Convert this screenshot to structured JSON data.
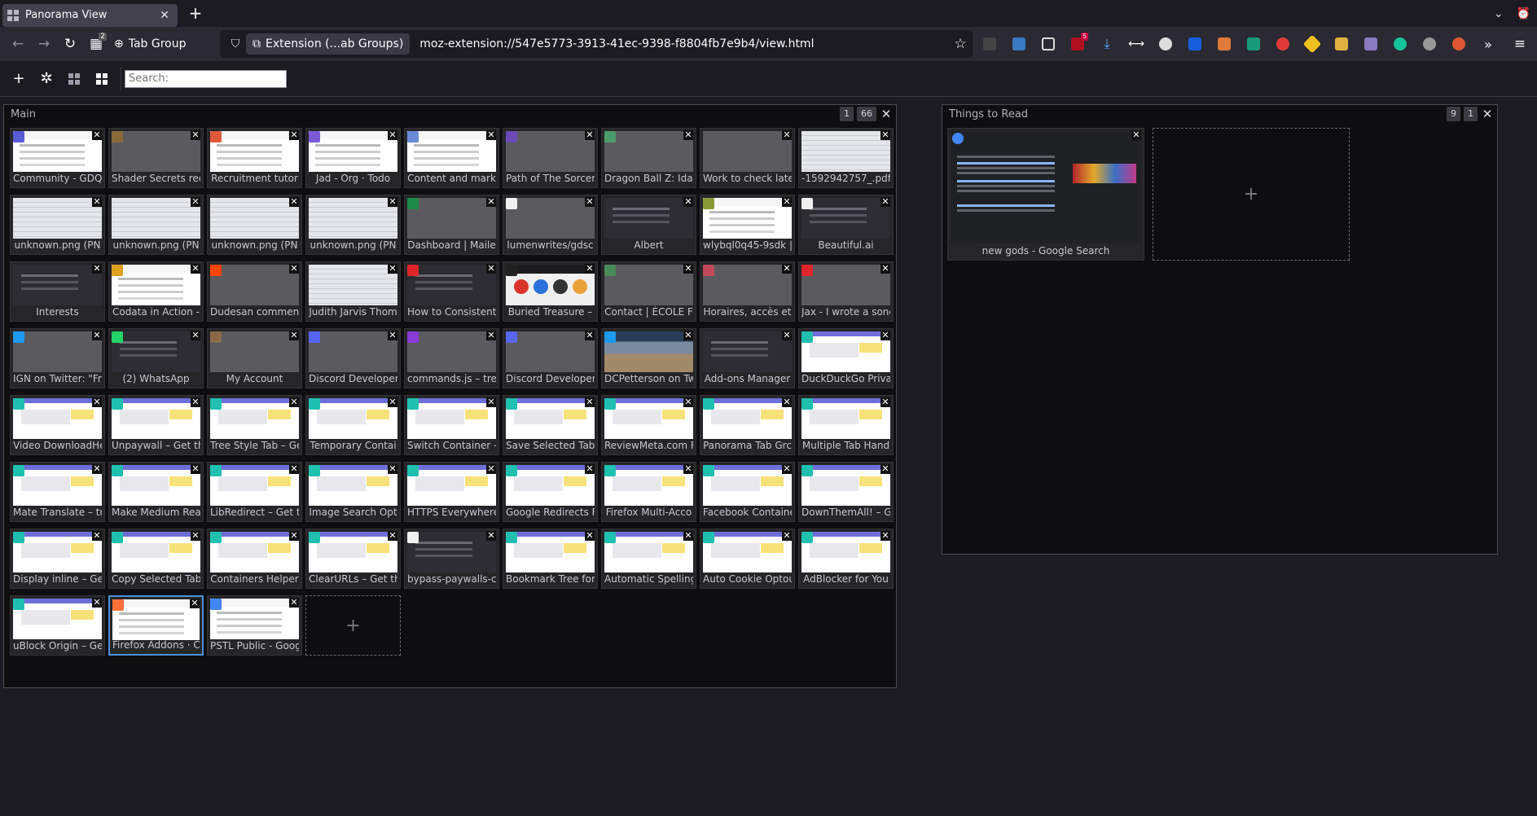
{
  "browser": {
    "tab_title": "Panorama View",
    "new_tab_label": "+",
    "url": "moz-extension://547e5773-3913-41ec-9398-f8804fb7e9b4/view.html",
    "identity_label": "Extension (...ab Groups)",
    "tab_group_label": "Tab Group",
    "extension_badge": "5",
    "tab_group_badge": "2"
  },
  "panorama": {
    "search_placeholder": "Search:"
  },
  "groups": [
    {
      "name": "Main",
      "badge_a": "1",
      "badge_b": "66",
      "tabs": [
        {
          "title": "Community - GDQ",
          "thumb": "page",
          "fav": "#5b5bd6"
        },
        {
          "title": "Shader Secrets rec",
          "thumb": "plain",
          "fav": "#8a6a3a"
        },
        {
          "title": "Recruitment tutor",
          "thumb": "page",
          "fav": "#e05a3a"
        },
        {
          "title": "Jad - Org · Todo",
          "thumb": "page",
          "fav": "#7a5ad6"
        },
        {
          "title": "Content and mark",
          "thumb": "page",
          "fav": "#6a8ad6"
        },
        {
          "title": "Path of The Sorcer",
          "thumb": "plain",
          "fav": "#6a4ab6"
        },
        {
          "title": "Dragon Ball Z: Idai",
          "thumb": "plain",
          "fav": "#4a9a6a"
        },
        {
          "title": "Work to check late",
          "thumb": "plain",
          "fav": ""
        },
        {
          "title": "-1592942757_.pdf",
          "thumb": "sheet",
          "fav": ""
        },
        {
          "title": "unknown.png (PN",
          "thumb": "sheet",
          "fav": ""
        },
        {
          "title": "unknown.png (PN",
          "thumb": "sheet",
          "fav": ""
        },
        {
          "title": "unknown.png (PN",
          "thumb": "sheet",
          "fav": ""
        },
        {
          "title": "unknown.png (PN",
          "thumb": "sheet",
          "fav": ""
        },
        {
          "title": "Dashboard | Maile",
          "thumb": "plain",
          "fav": "#1e8a4a"
        },
        {
          "title": "lumenwrites/gdsc",
          "thumb": "plain",
          "fav": "#f0f0f0"
        },
        {
          "title": "Albert",
          "thumb": "dark",
          "fav": ""
        },
        {
          "title": "wlybql0q45-9sdk |",
          "thumb": "page",
          "fav": "#8a9a3a"
        },
        {
          "title": "Beautiful.ai",
          "thumb": "dark",
          "fav": "#f0f0f0"
        },
        {
          "title": "Interests",
          "thumb": "dark",
          "fav": ""
        },
        {
          "title": "Codata in Action -",
          "thumb": "page",
          "fav": "#e0a020"
        },
        {
          "title": "Dudesan commen",
          "thumb": "plain",
          "fav": "#ff4500"
        },
        {
          "title": "Judith Jarvis Thom",
          "thumb": "sheet",
          "fav": ""
        },
        {
          "title": "How to Consistent",
          "thumb": "dark",
          "fav": "#e0262a"
        },
        {
          "title": "Buried Treasure –",
          "thumb": "media",
          "fav": "#222222"
        },
        {
          "title": "Contact | ÉCOLE F",
          "thumb": "plain",
          "fav": "#4a8a5a"
        },
        {
          "title": "Horaires, accès et",
          "thumb": "plain",
          "fav": "#c04a5a"
        },
        {
          "title": "Jax - I wrote a song",
          "thumb": "plain",
          "fav": "#e0262a"
        },
        {
          "title": "IGN on Twitter: \"Fr",
          "thumb": "plain",
          "fav": "#1d9bf0"
        },
        {
          "title": "(2) WhatsApp",
          "thumb": "dark",
          "fav": "#25d366"
        },
        {
          "title": "My Account",
          "thumb": "plain",
          "fav": "#8a6a4a"
        },
        {
          "title": "Discord Developer",
          "thumb": "plain",
          "fav": "#5865f2"
        },
        {
          "title": "commands.js – tre",
          "thumb": "plain",
          "fav": "#8a3ad6"
        },
        {
          "title": "Discord Developer",
          "thumb": "plain",
          "fav": "#5865f2"
        },
        {
          "title": "DCPetterson on Tw",
          "thumb": "photo",
          "fav": "#1d9bf0"
        },
        {
          "title": "Add-ons Manager",
          "thumb": "dark",
          "fav": ""
        },
        {
          "title": "DuckDuckGo Priva",
          "thumb": "amo",
          "fav": "#20c0b0"
        },
        {
          "title": "Video DownloadHe",
          "thumb": "amo",
          "fav": "#20c0b0"
        },
        {
          "title": "Unpaywall – Get th",
          "thumb": "amo",
          "fav": "#20c0b0"
        },
        {
          "title": "Tree Style Tab – Ge",
          "thumb": "amo",
          "fav": "#20c0b0"
        },
        {
          "title": "Temporary Contai",
          "thumb": "amo",
          "fav": "#20c0b0"
        },
        {
          "title": "Switch Container –",
          "thumb": "amo",
          "fav": "#20c0b0"
        },
        {
          "title": "Save Selected Tabs",
          "thumb": "amo",
          "fav": "#20c0b0"
        },
        {
          "title": "ReviewMeta.com F",
          "thumb": "amo",
          "fav": "#20c0b0"
        },
        {
          "title": "Panorama Tab Grc",
          "thumb": "amo",
          "fav": "#20c0b0"
        },
        {
          "title": "Multiple Tab Hand",
          "thumb": "amo",
          "fav": "#20c0b0"
        },
        {
          "title": "Mate Translate – tr",
          "thumb": "amo",
          "fav": "#20c0b0"
        },
        {
          "title": "Make Medium Rea",
          "thumb": "amo",
          "fav": "#20c0b0"
        },
        {
          "title": "LibRedirect – Get t",
          "thumb": "amo",
          "fav": "#20c0b0"
        },
        {
          "title": "Image Search Opt",
          "thumb": "amo",
          "fav": "#20c0b0"
        },
        {
          "title": "HTTPS Everywhere",
          "thumb": "amo",
          "fav": "#20c0b0"
        },
        {
          "title": "Google Redirects F",
          "thumb": "amo",
          "fav": "#20c0b0"
        },
        {
          "title": "Firefox Multi-Acco",
          "thumb": "amo",
          "fav": "#20c0b0"
        },
        {
          "title": "Facebook Containe",
          "thumb": "amo",
          "fav": "#20c0b0"
        },
        {
          "title": "DownThemAll! – G",
          "thumb": "amo",
          "fav": "#20c0b0"
        },
        {
          "title": "Display inline – Ge",
          "thumb": "amo",
          "fav": "#20c0b0"
        },
        {
          "title": "Copy Selected Tab",
          "thumb": "amo",
          "fav": "#20c0b0"
        },
        {
          "title": "Containers Helper",
          "thumb": "amo",
          "fav": "#20c0b0"
        },
        {
          "title": "ClearURLs – Get th",
          "thumb": "amo",
          "fav": "#20c0b0"
        },
        {
          "title": "bypass-paywalls-cl",
          "thumb": "dark",
          "fav": "#f0f0f0"
        },
        {
          "title": "Bookmark Tree for",
          "thumb": "amo",
          "fav": "#20c0b0"
        },
        {
          "title": "Automatic Spelling",
          "thumb": "amo",
          "fav": "#20c0b0"
        },
        {
          "title": "Auto Cookie Optou",
          "thumb": "amo",
          "fav": "#20c0b0"
        },
        {
          "title": "AdBlocker for You",
          "thumb": "amo",
          "fav": "#20c0b0"
        },
        {
          "title": "uBlock Origin – Ge",
          "thumb": "amo",
          "fav": "#20c0b0"
        },
        {
          "title": "Firefox Addons · C",
          "thumb": "page",
          "fav": "#ff7139",
          "selected": true
        },
        {
          "title": "PSTL Public - Goog",
          "thumb": "page",
          "fav": "#4285f4"
        }
      ]
    },
    {
      "name": "Things to Read",
      "badge_a": "9",
      "badge_b": "1",
      "tabs": [
        {
          "title": "new gods - Google Search",
          "thumb": "google",
          "fav": "#4285f4"
        }
      ]
    }
  ],
  "colors": {
    "accent": "#4a90d9",
    "amo_teal": "#20c0b0"
  }
}
